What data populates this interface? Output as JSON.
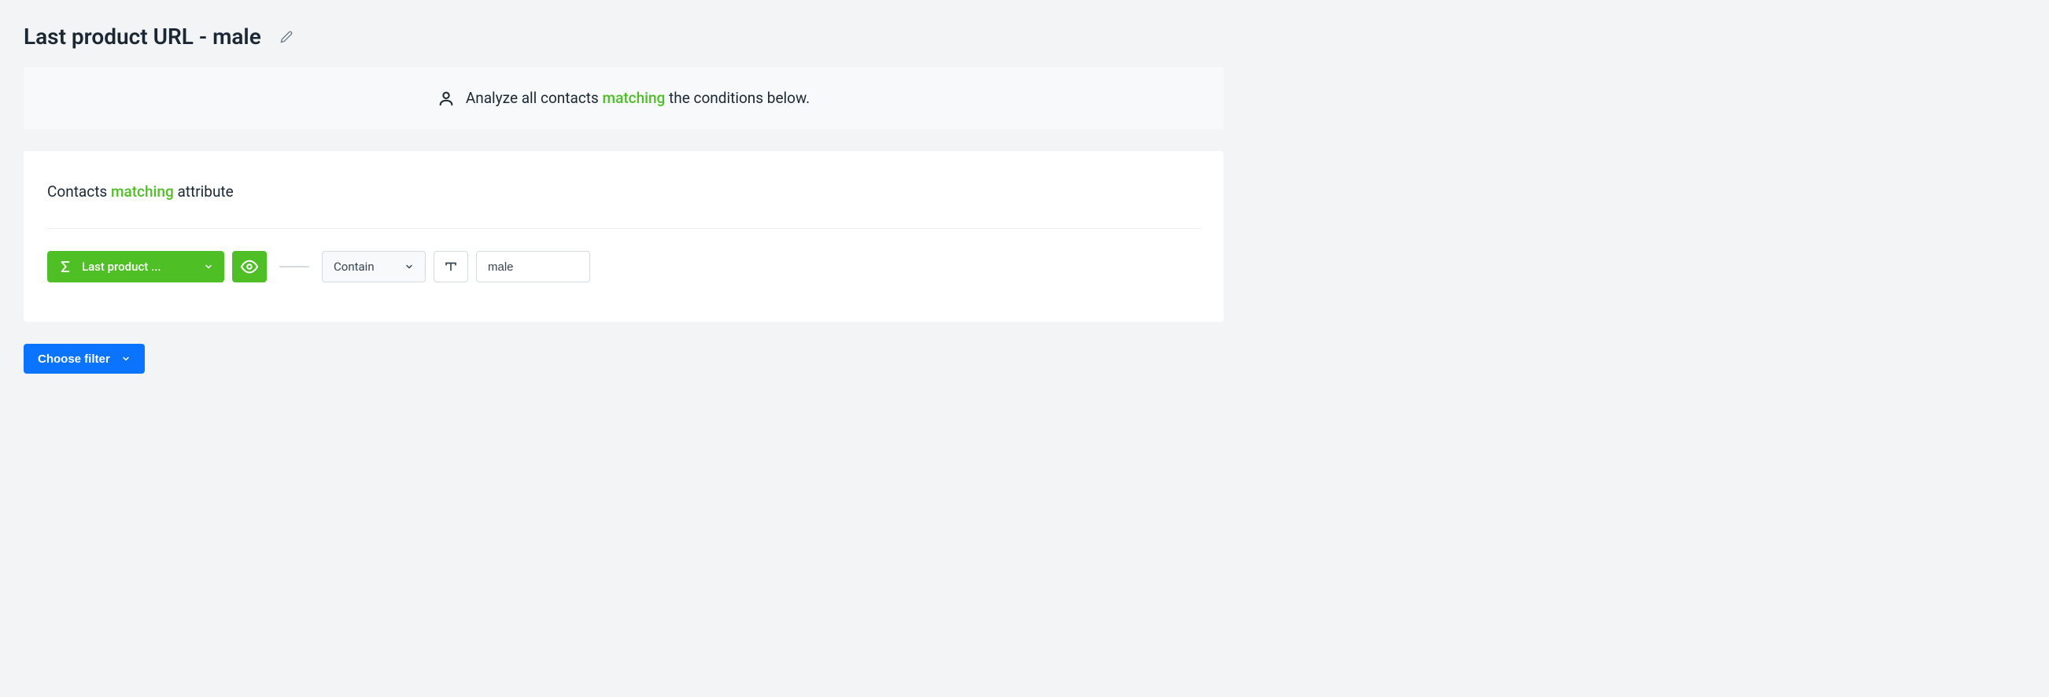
{
  "header": {
    "title": "Last product URL - male"
  },
  "banner": {
    "prefix": "Analyze all contacts",
    "match_word": "matching",
    "suffix": "the conditions below."
  },
  "filter_card": {
    "title_prefix": "Contacts",
    "title_match": "matching",
    "title_suffix": "attribute",
    "attribute_label": "Last product ...",
    "operator_label": "Contain",
    "value": "male"
  },
  "actions": {
    "choose_filter_label": "Choose filter"
  }
}
